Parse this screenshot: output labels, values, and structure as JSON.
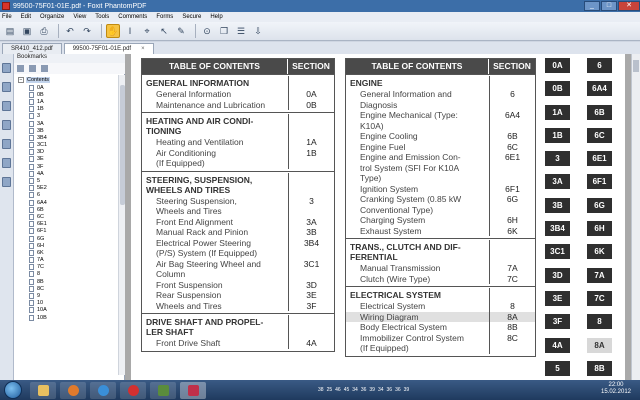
{
  "window": {
    "title": "99500-75F01-01E.pdf - Foxit PhantomPDF",
    "buttons": [
      "_",
      "□",
      "✕"
    ]
  },
  "menu": [
    "File",
    "Edit",
    "Organize",
    "View",
    "Tools",
    "Comments",
    "Forms",
    "Secure",
    "Help"
  ],
  "tabs": [
    {
      "label": "SR410_412.pdf"
    },
    {
      "label": "99500-75F01-01E.pdf"
    }
  ],
  "bookmarks": {
    "header": "Bookmarks",
    "root": "Contents",
    "items": [
      "0A",
      "0B",
      "1A",
      "1B",
      "3",
      "3A",
      "3B",
      "3B4",
      "3C1",
      "3D",
      "3E",
      "3F",
      "4A",
      "5",
      "5E2",
      "6",
      "6A4",
      "6B",
      "6C",
      "6E1",
      "6F1",
      "6G",
      "6H",
      "6K",
      "7A",
      "7C",
      "8",
      "8B",
      "8C",
      "9",
      "10",
      "10A",
      "10B"
    ]
  },
  "toc_left": {
    "header": {
      "title": "TABLE OF CONTENTS",
      "section": "SECTION"
    },
    "groups": [
      {
        "title": "GENERAL INFORMATION",
        "rows": [
          {
            "name": "General Information",
            "code": "0A"
          },
          {
            "name": "Maintenance and Lubrication",
            "code": "0B"
          }
        ]
      },
      {
        "title": "HEATING AND AIR CONDI-\nTIONING",
        "rows": [
          {
            "name": "Heating and Ventilation",
            "code": "1A"
          },
          {
            "name": "Air Conditioning\n(If Equipped)",
            "code": "1B"
          }
        ]
      },
      {
        "title": "STEERING, SUSPENSION,\nWHEELS AND TIRES",
        "rows": [
          {
            "name": "Steering Suspension,\nWheels and Tires",
            "code": "3"
          },
          {
            "name": "Front End Alignment",
            "code": "3A"
          },
          {
            "name": "Manual Rack and Pinion",
            "code": "3B"
          },
          {
            "name": "Electrical Power Steering\n(P/S) System (If Equipped)",
            "code": "3B4"
          },
          {
            "name": "Air Bag Steering Wheel and\nColumn",
            "code": "3C1"
          },
          {
            "name": "Front Suspension",
            "code": "3D"
          },
          {
            "name": "Rear Suspension",
            "code": "3E"
          },
          {
            "name": "Wheels and Tires",
            "code": "3F"
          }
        ]
      },
      {
        "title": "DRIVE SHAFT AND PROPEL-\nLER SHAFT",
        "rows": [
          {
            "name": "Front Drive Shaft",
            "code": "4A"
          }
        ]
      }
    ]
  },
  "toc_right": {
    "header": {
      "title": "TABLE OF CONTENTS",
      "section": "SECTION"
    },
    "groups": [
      {
        "title": "ENGINE",
        "rows": [
          {
            "name": "General Information and\nDiagnosis",
            "code": "6"
          },
          {
            "name": "Engine Mechanical (Type:\nK10A)",
            "code": "6A4"
          },
          {
            "name": "Engine Cooling",
            "code": "6B"
          },
          {
            "name": "Engine Fuel",
            "code": "6C"
          },
          {
            "name": "Engine and Emission Con-\ntrol System (SFI For K10A\nType)",
            "code": "6E1"
          },
          {
            "name": "Ignition System",
            "code": "6F1"
          },
          {
            "name": "Cranking System (0.85 kW\nConventional Type)",
            "code": "6G"
          },
          {
            "name": "Charging System",
            "code": "6H"
          },
          {
            "name": "Exhaust System",
            "code": "6K"
          }
        ]
      },
      {
        "title": "TRANS., CLUTCH AND DIF-\nFERENTIAL",
        "rows": [
          {
            "name": "Manual Transmission",
            "code": "7A"
          },
          {
            "name": "Clutch (Wire Type)",
            "code": "7C"
          }
        ]
      },
      {
        "title": "ELECTRICAL SYSTEM",
        "rows": [
          {
            "name": "Electrical System",
            "code": "8"
          },
          {
            "name": "Wiring Diagram",
            "code": "8A",
            "highlight": true
          },
          {
            "name": "Body Electrical System",
            "code": "8B"
          },
          {
            "name": "Immobilizer Control System\n(If Equipped)",
            "code": "8C"
          }
        ]
      }
    ]
  },
  "section_tabs": {
    "col1": [
      "0A",
      "0B",
      "1A",
      "1B",
      "3",
      "3A",
      "3B",
      "3B4",
      "3C1",
      "3D",
      "3E",
      "3F",
      "4A",
      "5"
    ],
    "col2": [
      "6",
      "6A4",
      "6B",
      "6C",
      "6E1",
      "6F1",
      "6G",
      "6H",
      "6K",
      "7A",
      "7C",
      "8",
      "8A",
      "8B"
    ],
    "col2_light": [
      "8A"
    ]
  },
  "taskbar": {
    "tray_numbers": [
      "38",
      "25",
      "46",
      "45",
      "34",
      "36",
      "39",
      "34",
      "36",
      "36",
      "39"
    ],
    "time": "22:00",
    "date": "15.02.2012"
  }
}
